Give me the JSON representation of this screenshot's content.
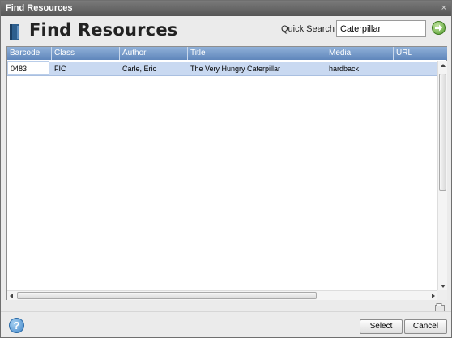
{
  "window": {
    "title": "Find Resources",
    "close_glyph": "×"
  },
  "header": {
    "title": "Find Resources",
    "icon": "book-icon"
  },
  "quick_search": {
    "label": "Quick Search",
    "value": "Caterpillar",
    "go_icon": "go-arrow-icon"
  },
  "grid": {
    "columns": [
      "Barcode",
      "Class",
      "Author",
      "Title",
      "Media",
      "URL"
    ],
    "rows": [
      {
        "barcode": "0483",
        "class": "FIC",
        "author": "Carle, Eric",
        "title": "The Very Hungry Caterpillar",
        "media": "hardback",
        "url": ""
      }
    ]
  },
  "footer": {
    "help_icon": "help-icon",
    "help_glyph": "?",
    "select_label": "Select",
    "cancel_label": "Cancel"
  },
  "colors": {
    "header_blue": "#5f86bb",
    "selected_row": "#c9d9f1",
    "go_green": "#4f9a2a",
    "help_blue": "#3f84c8"
  }
}
